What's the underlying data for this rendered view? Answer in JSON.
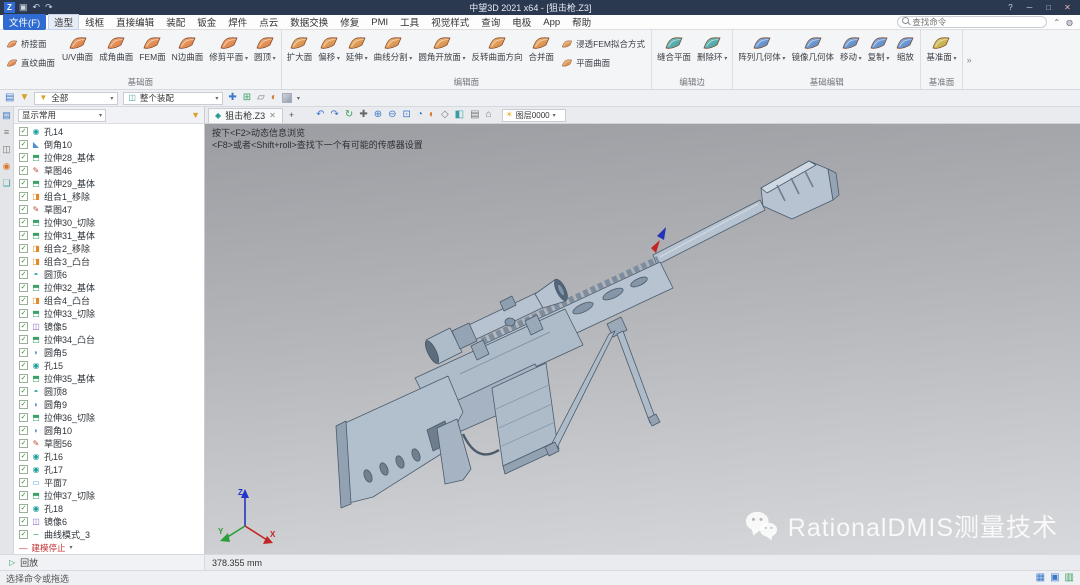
{
  "title_bar": {
    "title": "中望3D 2021 x64 - [狙击枪.Z3]",
    "icons": [
      {
        "name": "save-icon",
        "glyph": "▣",
        "color": "#cfd6e2"
      },
      {
        "name": "undo-icon",
        "glyph": "↶",
        "color": "#cfd6e2"
      },
      {
        "name": "redo-icon",
        "glyph": "↷",
        "color": "#cfd6e2"
      }
    ],
    "window_buttons": [
      {
        "name": "help-button",
        "glyph": "?"
      },
      {
        "name": "minimize-button",
        "glyph": "─"
      },
      {
        "name": "maximize-button",
        "glyph": "□"
      },
      {
        "name": "close-button",
        "glyph": "✕"
      }
    ]
  },
  "menu_bar": {
    "items": [
      "文件(F)",
      "造型",
      "线框",
      "直接编辑",
      "装配",
      "钣金",
      "焊件",
      "点云",
      "数据交换",
      "修复",
      "PMI",
      "工具",
      "视觉样式",
      "查询",
      "电极",
      "App",
      "帮助"
    ],
    "active": "造型",
    "search_placeholder": "查找命令"
  },
  "ribbon": {
    "groups": [
      {
        "label": "基础面",
        "buttons": [
          {
            "stack": [
              {
                "label": "桥接面"
              },
              {
                "label": "直纹曲面"
              }
            ]
          },
          {
            "label": "U/V曲面"
          },
          {
            "label": "成角曲面"
          },
          {
            "label": "FEM面"
          },
          {
            "label": "N边曲面"
          },
          {
            "label": "修剪平面",
            "arrow": true
          },
          {
            "label": "圆顶",
            "arrow": true
          }
        ]
      },
      {
        "label": "编辑面",
        "buttons": [
          {
            "label": "扩大面"
          },
          {
            "label": "偏移",
            "arrow": true
          },
          {
            "label": "延伸",
            "arrow": true
          },
          {
            "label": "曲线分割",
            "arrow": true
          },
          {
            "label": "圆角开放面",
            "arrow": true
          },
          {
            "label": "反转曲面方向"
          },
          {
            "label": "合并面"
          },
          {
            "stack": [
              {
                "label": "浸透FEM拟合方式"
              },
              {
                "label": "平面曲面"
              }
            ]
          }
        ]
      },
      {
        "label": "编辑边",
        "buttons": [
          {
            "label": "缝合平面"
          },
          {
            "label": "删除环",
            "arrow": true
          }
        ]
      },
      {
        "label": "基础编辑",
        "buttons": [
          {
            "label": "阵列几何体",
            "arrow": true
          },
          {
            "label": "镜像几何体"
          },
          {
            "label": "移动",
            "arrow": true
          },
          {
            "label": "复制",
            "arrow": true
          },
          {
            "label": "缩放"
          }
        ]
      },
      {
        "label": "基准面",
        "buttons": [
          {
            "label": "基准面",
            "arrow": true
          }
        ]
      }
    ]
  },
  "quick_bar": {
    "left_icons": [
      {
        "name": "panel-toggle-icon",
        "glyph": "▤",
        "color": "#3b78c9"
      },
      {
        "name": "selection-filter-icon",
        "glyph": "▼",
        "color": "#d9a22a"
      }
    ],
    "filter_value": "全部",
    "assembly_value": "整个装配",
    "right_icons": [
      {
        "name": "pick-point-icon",
        "glyph": "✚",
        "color": "#3b78c9"
      },
      {
        "name": "grid-snap-icon",
        "glyph": "⊞",
        "color": "#3b9e5f"
      },
      {
        "name": "plane-snap-icon",
        "glyph": "▱",
        "color": "#777777"
      },
      {
        "name": "shaded-display-icon",
        "glyph": "◐",
        "color": "#d9772a"
      }
    ]
  },
  "manager": {
    "side_icons": [
      {
        "name": "manager-tab-icon",
        "glyph": "▤",
        "color": "#3b78c9"
      },
      {
        "name": "history-tab-icon",
        "glyph": "≡",
        "color": "#777777"
      },
      {
        "name": "assembly-tab-icon",
        "glyph": "◫",
        "color": "#777777"
      },
      {
        "name": "visual-tab-icon",
        "glyph": "◉",
        "color": "#d9772a"
      },
      {
        "name": "layer-tab-icon",
        "glyph": "❏",
        "color": "#3b9e9e"
      }
    ],
    "header_label": "显示常用",
    "items": [
      {
        "label": "孔14",
        "type": "hole"
      },
      {
        "label": "倒角10",
        "type": "chamfer"
      },
      {
        "label": "拉伸28_基体",
        "type": "extrude"
      },
      {
        "label": "草图46",
        "type": "sketch"
      },
      {
        "label": "拉伸29_基体",
        "type": "extrude"
      },
      {
        "label": "组合1_移除",
        "type": "combine"
      },
      {
        "label": "草图47",
        "type": "sketch"
      },
      {
        "label": "拉伸30_切除",
        "type": "extrude"
      },
      {
        "label": "拉伸31_基体",
        "type": "extrude"
      },
      {
        "label": "组合2_移除",
        "type": "combine"
      },
      {
        "label": "组合3_凸台",
        "type": "combine"
      },
      {
        "label": "圆顶6",
        "type": "dome"
      },
      {
        "label": "拉伸32_基体",
        "type": "extrude"
      },
      {
        "label": "组合4_凸台",
        "type": "combine"
      },
      {
        "label": "拉伸33_切除",
        "type": "extrude"
      },
      {
        "label": "镜像5",
        "type": "mirror"
      },
      {
        "label": "拉伸34_凸台",
        "type": "extrude"
      },
      {
        "label": "圆角5",
        "type": "fillet"
      },
      {
        "label": "孔15",
        "type": "hole"
      },
      {
        "label": "拉伸35_基体",
        "type": "extrude"
      },
      {
        "label": "圆顶8",
        "type": "dome"
      },
      {
        "label": "圆角9",
        "type": "fillet"
      },
      {
        "label": "拉伸36_切除",
        "type": "extrude"
      },
      {
        "label": "圆角10",
        "type": "fillet"
      },
      {
        "label": "草图56",
        "type": "sketch"
      },
      {
        "label": "孔16",
        "type": "hole"
      },
      {
        "label": "孔17",
        "type": "hole"
      },
      {
        "label": "平面7",
        "type": "plane"
      },
      {
        "label": "拉伸37_切除",
        "type": "extrude"
      },
      {
        "label": "孔18",
        "type": "hole"
      },
      {
        "label": "镜像6",
        "type": "mirror"
      },
      {
        "label": "曲线模式_3",
        "type": "curve"
      },
      {
        "label": "建模停止",
        "type": "stop"
      }
    ],
    "replay_label": "回放"
  },
  "viewport": {
    "document_tab": "狙击枪.Z3",
    "new_tab_label": "+",
    "toolbar_icons": [
      {
        "name": "undo-icon",
        "glyph": "↶",
        "color": "#3b78c9"
      },
      {
        "name": "redo-icon",
        "glyph": "↷",
        "color": "#3b78c9"
      },
      {
        "name": "regen-icon",
        "glyph": "↻",
        "color": "#3b9e5f"
      },
      {
        "name": "pick-icon",
        "glyph": "✚",
        "color": "#666666"
      },
      {
        "name": "zoom-in-icon",
        "glyph": "⊕",
        "color": "#3b78c9"
      },
      {
        "name": "zoom-out-icon",
        "glyph": "⊖",
        "color": "#3b78c9"
      },
      {
        "name": "zoom-fit-icon",
        "glyph": "⊡",
        "color": "#3b78c9"
      },
      {
        "name": "rotate-view-icon",
        "glyph": "◔",
        "color": "#3b78c9"
      },
      {
        "name": "shaded-mode-icon",
        "glyph": "◐",
        "color": "#d9772a"
      },
      {
        "name": "wireframe-mode-icon",
        "glyph": "◇",
        "color": "#777777"
      },
      {
        "name": "section-view-icon",
        "glyph": "◧",
        "color": "#3b9e9e"
      },
      {
        "name": "background-icon",
        "glyph": "▤",
        "color": "#777777"
      },
      {
        "name": "home-view-icon",
        "glyph": "⌂",
        "color": "#777777"
      }
    ],
    "layer_value": "图层0000",
    "hint_line1": "按下<F2>动态信息浏览",
    "hint_line2": "<F8>或者<Shift+roll>查找下一个有可能的传感器设置",
    "axes": {
      "x": "X",
      "y": "Y",
      "z": "Z"
    },
    "measurement": "378.355 mm"
  },
  "watermark": {
    "text": "RationalDMIS测量技术"
  },
  "status_bar": {
    "message": "选择命令或拖选",
    "icons": [
      {
        "name": "status-grid-icon",
        "glyph": "▦",
        "color": "#3b78c9"
      },
      {
        "name": "status-monitor-icon",
        "glyph": "▣",
        "color": "#3b78c9"
      },
      {
        "name": "status-doc-icon",
        "glyph": "▥",
        "color": "#3b9e5f"
      }
    ]
  }
}
